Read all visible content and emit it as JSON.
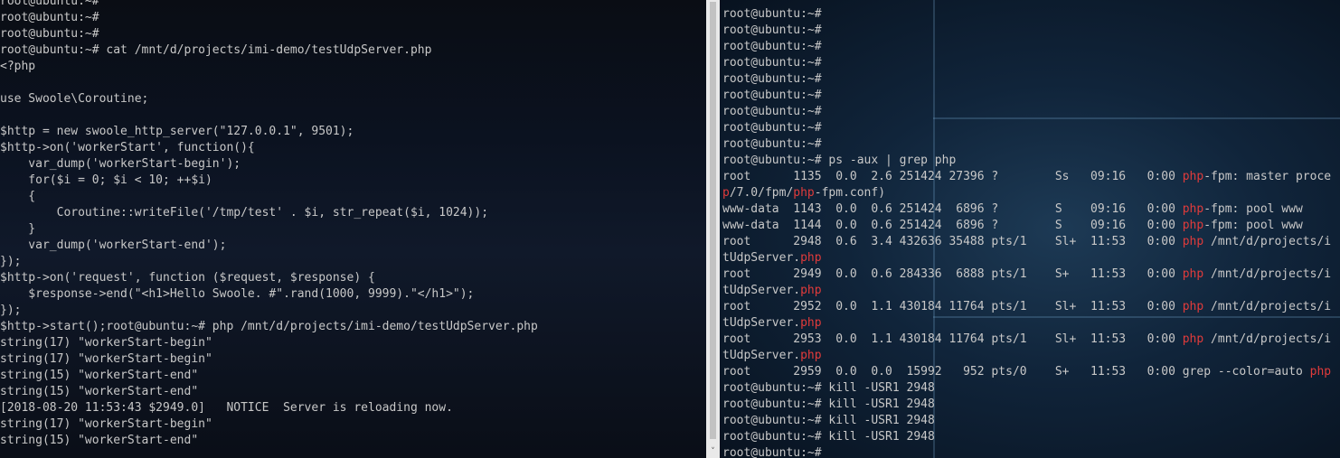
{
  "left_terminal": {
    "lines": [
      "root@ubuntu:~#",
      "root@ubuntu:~#",
      "root@ubuntu:~#",
      "root@ubuntu:~# cat /mnt/d/projects/imi-demo/testUdpServer.php",
      "<?php",
      "",
      "use Swoole\\Coroutine;",
      "",
      "$http = new swoole_http_server(\"127.0.0.1\", 9501);",
      "$http->on('workerStart', function(){",
      "    var_dump('workerStart-begin');",
      "    for($i = 0; $i < 10; ++$i)",
      "    {",
      "        Coroutine::writeFile('/tmp/test' . $i, str_repeat($i, 1024));",
      "    }",
      "    var_dump('workerStart-end');",
      "});",
      "$http->on('request', function ($request, $response) {",
      "    $response->end(\"<h1>Hello Swoole. #\".rand(1000, 9999).\"</h1>\");",
      "});",
      "$http->start();root@ubuntu:~# php /mnt/d/projects/imi-demo/testUdpServer.php",
      "string(17) \"workerStart-begin\"",
      "string(17) \"workerStart-begin\"",
      "string(15) \"workerStart-end\"",
      "string(15) \"workerStart-end\"",
      "[2018-08-20 11:53:43 $2949.0]   NOTICE  Server is reloading now.",
      "string(17) \"workerStart-begin\"",
      "string(15) \"workerStart-end\""
    ]
  },
  "right_terminal": {
    "lines": [
      [
        {
          "t": "root@ubuntu:~#"
        }
      ],
      [
        {
          "t": "root@ubuntu:~#"
        }
      ],
      [
        {
          "t": "root@ubuntu:~#"
        }
      ],
      [
        {
          "t": "root@ubuntu:~#"
        }
      ],
      [
        {
          "t": "root@ubuntu:~#"
        }
      ],
      [
        {
          "t": "root@ubuntu:~#"
        }
      ],
      [
        {
          "t": "root@ubuntu:~#"
        }
      ],
      [
        {
          "t": "root@ubuntu:~#"
        }
      ],
      [
        {
          "t": "root@ubuntu:~#"
        }
      ],
      [
        {
          "t": "root@ubuntu:~# ps -aux | grep php"
        }
      ],
      [
        {
          "t": "root      1135  0.0  2.6 251424 27396 ?        Ss   09:16   0:00 "
        },
        {
          "t": "php",
          "h": true
        },
        {
          "t": "-fpm: master proce"
        }
      ],
      [
        {
          "t": "p",
          "h": true
        },
        {
          "t": "/7.0/fpm/"
        },
        {
          "t": "php",
          "h": true
        },
        {
          "t": "-fpm.conf)"
        }
      ],
      [
        {
          "t": "www-data  1143  0.0  0.6 251424  6896 ?        S    09:16   0:00 "
        },
        {
          "t": "php",
          "h": true
        },
        {
          "t": "-fpm: pool www"
        }
      ],
      [
        {
          "t": "www-data  1144  0.0  0.6 251424  6896 ?        S    09:16   0:00 "
        },
        {
          "t": "php",
          "h": true
        },
        {
          "t": "-fpm: pool www"
        }
      ],
      [
        {
          "t": "root      2948  0.6  3.4 432636 35488 pts/1    Sl+  11:53   0:00 "
        },
        {
          "t": "php",
          "h": true
        },
        {
          "t": " /mnt/d/projects/i"
        }
      ],
      [
        {
          "t": "tUdpServer."
        },
        {
          "t": "php",
          "h": true
        }
      ],
      [
        {
          "t": "root      2949  0.0  0.6 284336  6888 pts/1    S+   11:53   0:00 "
        },
        {
          "t": "php",
          "h": true
        },
        {
          "t": " /mnt/d/projects/i"
        }
      ],
      [
        {
          "t": "tUdpServer."
        },
        {
          "t": "php",
          "h": true
        }
      ],
      [
        {
          "t": "root      2952  0.0  1.1 430184 11764 pts/1    Sl+  11:53   0:00 "
        },
        {
          "t": "php",
          "h": true
        },
        {
          "t": " /mnt/d/projects/i"
        }
      ],
      [
        {
          "t": "tUdpServer."
        },
        {
          "t": "php",
          "h": true
        }
      ],
      [
        {
          "t": "root      2953  0.0  1.1 430184 11764 pts/1    Sl+  11:53   0:00 "
        },
        {
          "t": "php",
          "h": true
        },
        {
          "t": " /mnt/d/projects/i"
        }
      ],
      [
        {
          "t": "tUdpServer."
        },
        {
          "t": "php",
          "h": true
        }
      ],
      [
        {
          "t": "root      2959  0.0  0.0  15992   952 pts/0    S+   11:53   0:00 grep --color=auto "
        },
        {
          "t": "php",
          "h": true
        }
      ],
      [
        {
          "t": "root@ubuntu:~# kill -USR1 2948"
        }
      ],
      [
        {
          "t": "root@ubuntu:~# kill -USR1 2948"
        }
      ],
      [
        {
          "t": "root@ubuntu:~# kill -USR1 2948"
        }
      ],
      [
        {
          "t": "root@ubuntu:~# kill -USR1 2948"
        }
      ],
      [
        {
          "t": "root@ubuntu:~#"
        }
      ]
    ]
  },
  "scrollbar": {
    "down_arrow": "˅"
  },
  "colors": {
    "text": "#c8c8c8",
    "highlight": "#e03b3b"
  }
}
